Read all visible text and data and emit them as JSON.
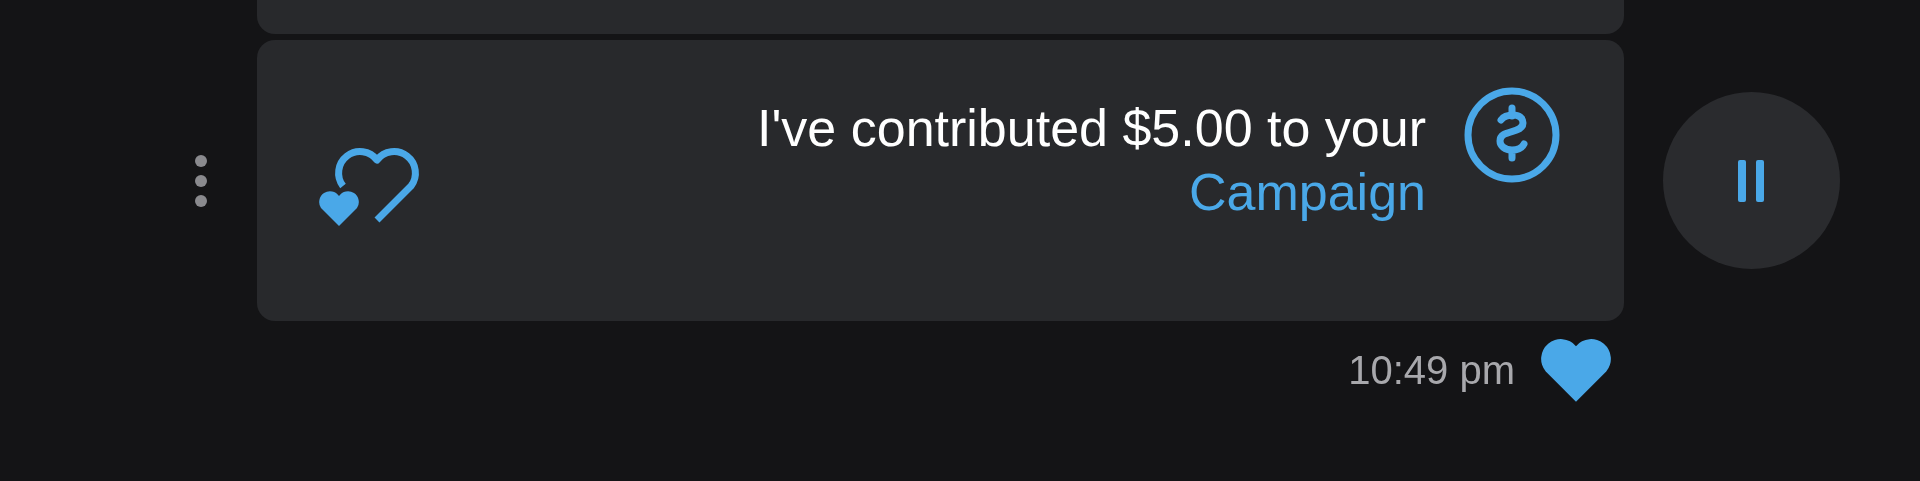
{
  "audio_player": {
    "playing": true
  },
  "message": {
    "kind": "tip",
    "text": "I've contributed $5.00 to your",
    "link": "Campaign",
    "time": "10:49 pm",
    "liked": true
  }
}
